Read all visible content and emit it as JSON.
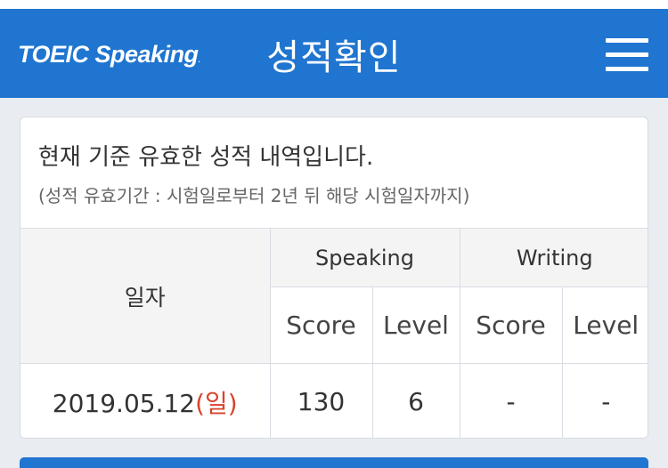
{
  "header": {
    "logo_text": "TOEIC Speaking",
    "logo_mark": ".",
    "title": "성적확인",
    "menu_icon": "hamburger-menu-icon"
  },
  "notice": {
    "main": "현재 기준 유효한 성적 내역입니다.",
    "sub": "(성적 유효기간 : 시험일로부터 2년 뒤 해당 시험일자까지)"
  },
  "table": {
    "date_header": "일자",
    "groups": [
      "Speaking",
      "Writing"
    ],
    "subheaders": [
      "Score",
      "Level",
      "Score",
      "Level"
    ],
    "rows": [
      {
        "date": "2019.05.12",
        "weekday": "(일)",
        "speaking_score": "130",
        "speaking_level": "6",
        "writing_score": "-",
        "writing_level": "-"
      }
    ]
  },
  "colors": {
    "brand_blue": "#1f75d0",
    "sunday_red": "#d9432b",
    "background": "#e9ecf1"
  }
}
